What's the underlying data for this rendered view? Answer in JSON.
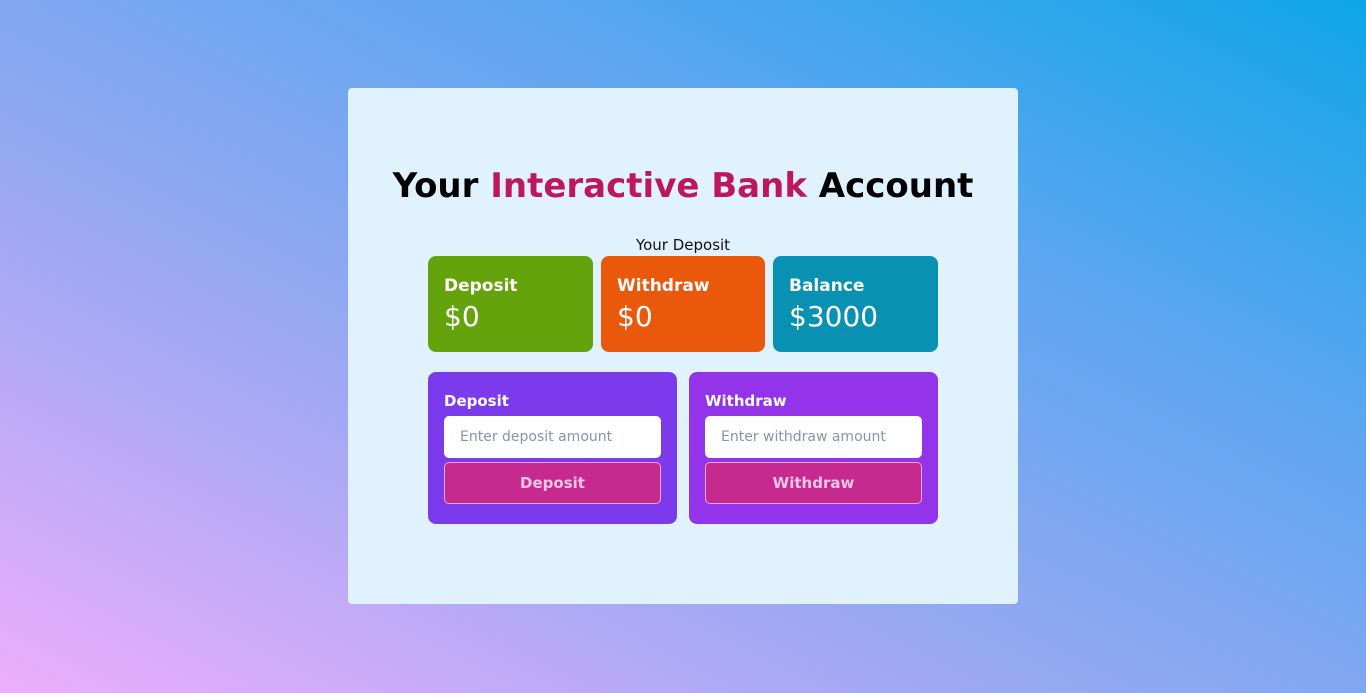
{
  "title": {
    "part1": "Your ",
    "highlight": "Interactive Bank",
    "part2": " Account"
  },
  "subtitle": "Your Deposit",
  "stats": {
    "deposit": {
      "label": "Deposit",
      "value": "$0"
    },
    "withdraw": {
      "label": "Withdraw",
      "value": "$0"
    },
    "balance": {
      "label": "Balance",
      "value": "$3000"
    }
  },
  "forms": {
    "deposit": {
      "label": "Deposit",
      "placeholder": "Enter deposit amount",
      "value": "",
      "button": "Deposit"
    },
    "withdraw": {
      "label": "Withdraw",
      "placeholder": "Enter withdraw amount",
      "value": "",
      "button": "Withdraw"
    }
  },
  "colors": {
    "title_highlight": "#be185d",
    "panel_bg": "#e0f2fe",
    "deposit_card": "#65a30d",
    "withdraw_card": "#ea580c",
    "balance_card": "#0891b2",
    "deposit_form": "#7c3aed",
    "withdraw_form": "#9333ea",
    "button": "#c62a8f"
  }
}
